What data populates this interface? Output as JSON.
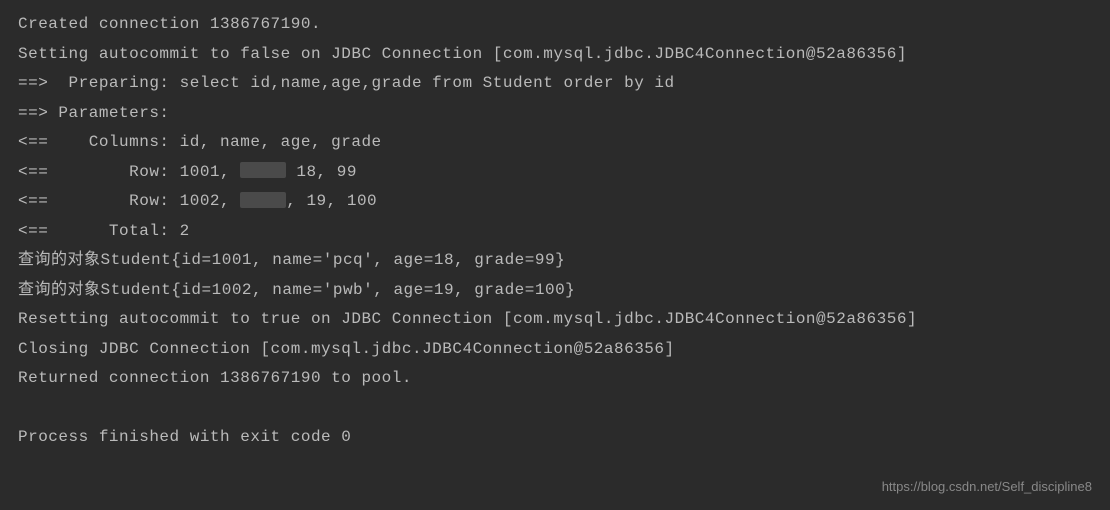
{
  "console": {
    "lines": [
      "Created connection 1386767190.",
      "Setting autocommit to false on JDBC Connection [com.mysql.jdbc.JDBC4Connection@52a86356]",
      "==>  Preparing: select id,name,age,grade from Student order by id ",
      "==> Parameters: ",
      "<==    Columns: id, name, age, grade",
      "<==        Row: 1001, [OBSCURED] 18, 99",
      "<==        Row: 1002, [OBSCURED], 19, 100",
      "<==      Total: 2",
      "查询的对象Student{id=1001, name='pcq', age=18, grade=99}",
      "查询的对象Student{id=1002, name='pwb', age=19, grade=100}",
      "Resetting autocommit to true on JDBC Connection [com.mysql.jdbc.JDBC4Connection@52a86356]",
      "Closing JDBC Connection [com.mysql.jdbc.JDBC4Connection@52a86356]",
      "Returned connection 1386767190 to pool.",
      "",
      "Process finished with exit code 0"
    ],
    "row1_prefix": "<==        Row: 1001, ",
    "row1_suffix": " 18, 99",
    "row2_prefix": "<==        Row: 1002, ",
    "row2_suffix": ", 19, 100"
  },
  "watermark": "https://blog.csdn.net/Self_discipline8"
}
